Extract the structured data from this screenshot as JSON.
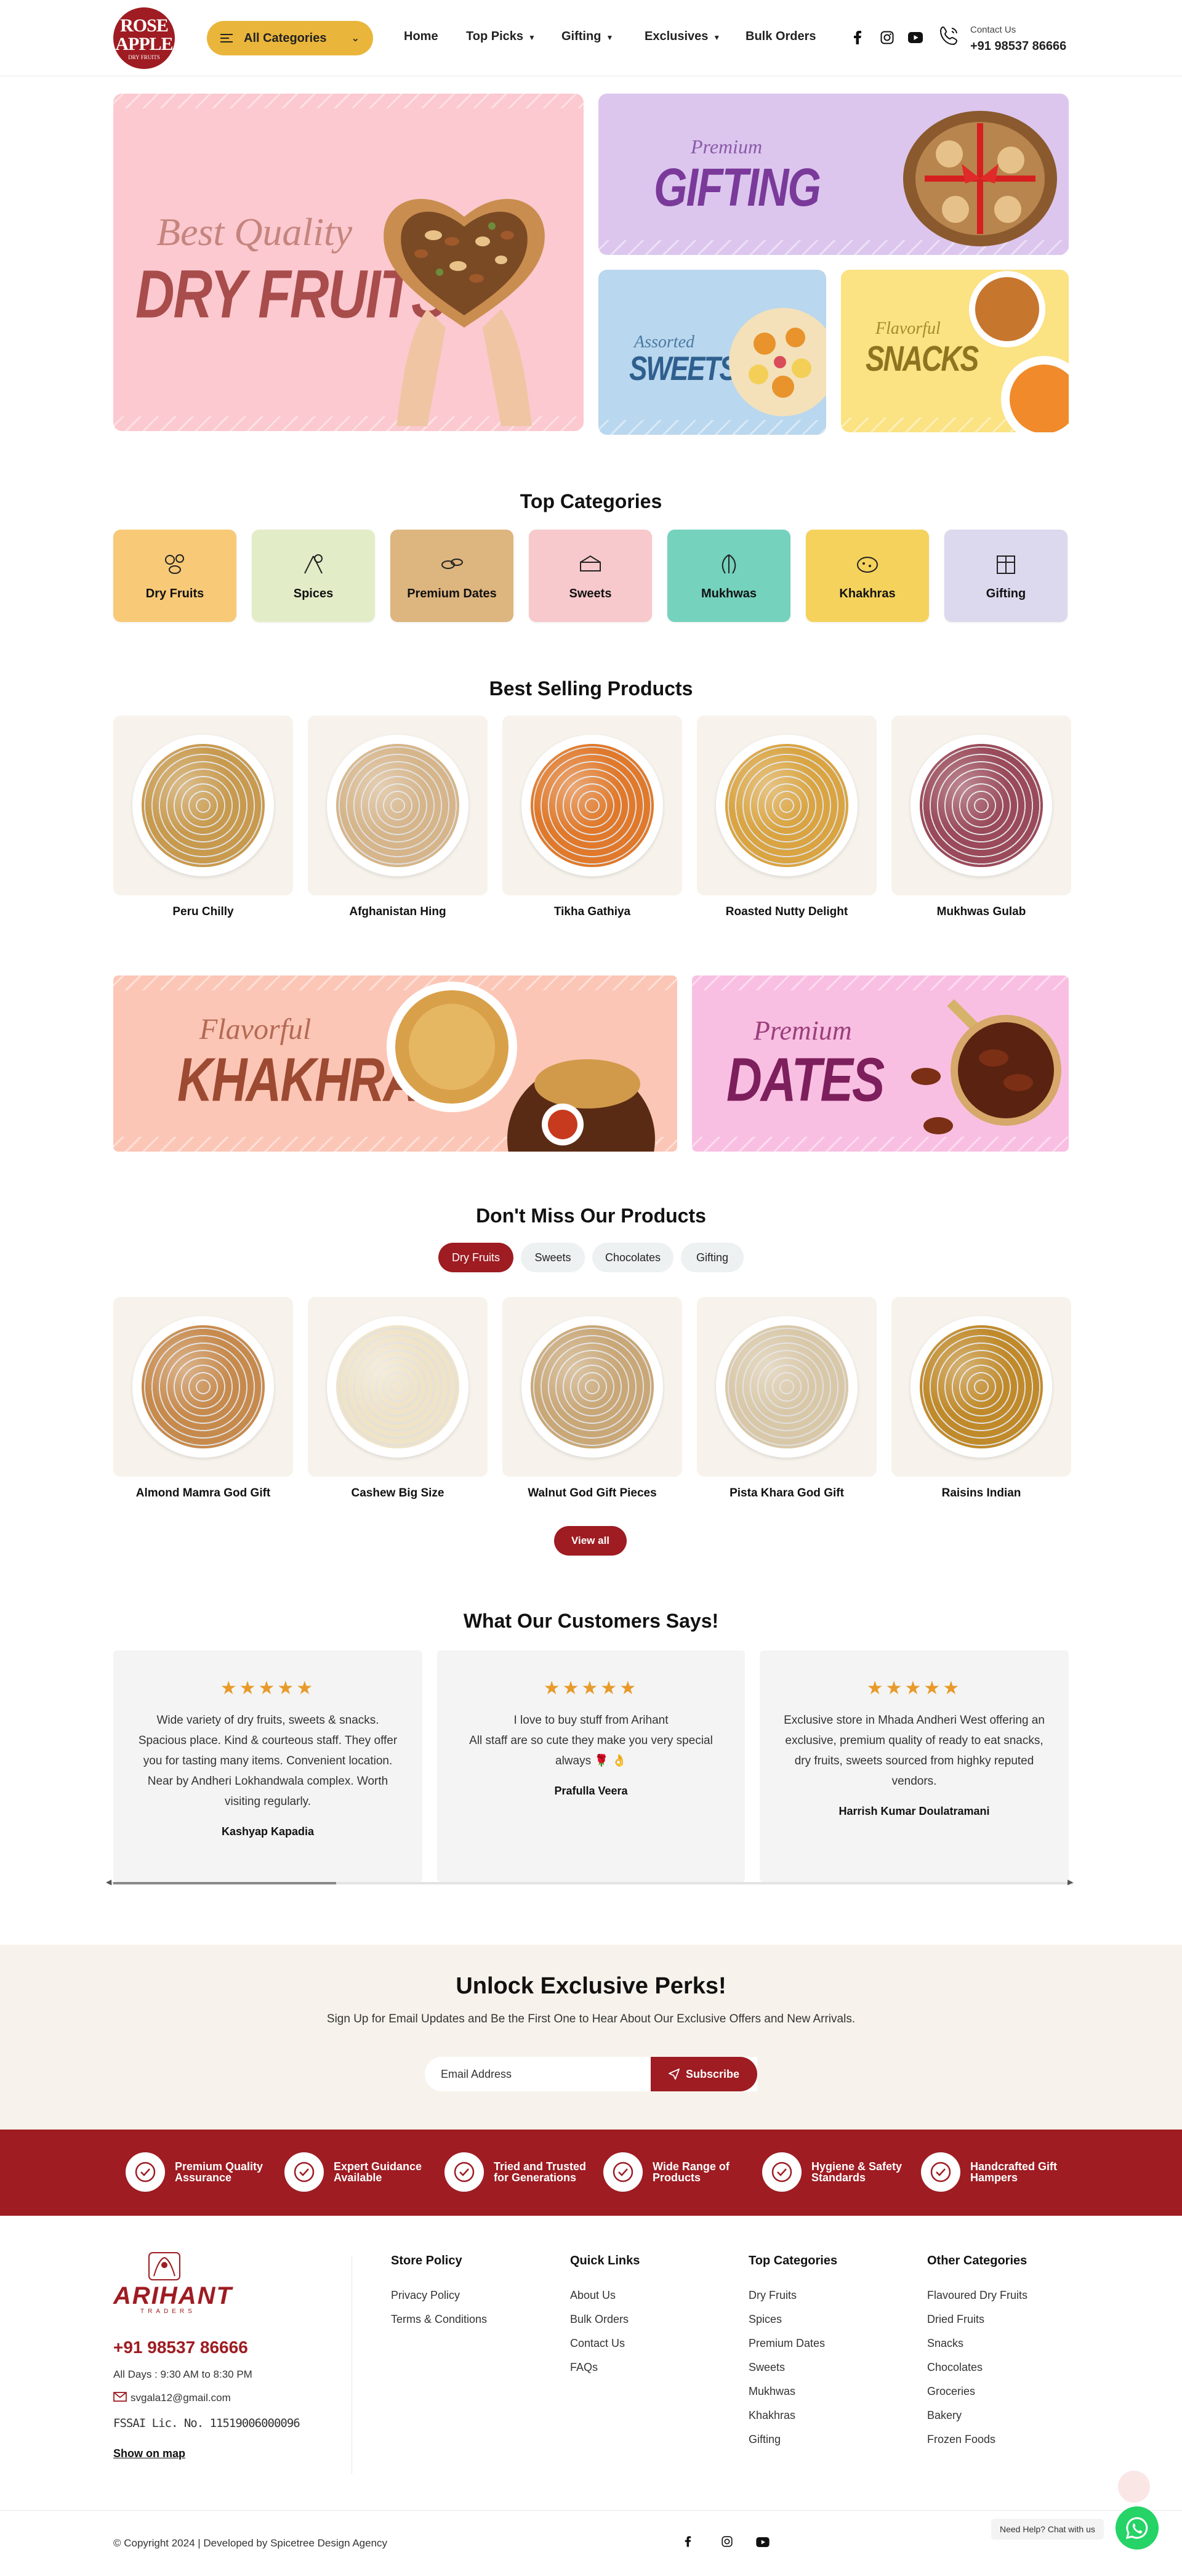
{
  "colors": {
    "brand": "#9e1c22",
    "accent": "#e9b53a",
    "cream": "#f7f3ec"
  },
  "header": {
    "logo_line1": "ROSE",
    "logo_line2": "APPLE",
    "logo_tag": "DRY FRUITS",
    "all_categories": "All Categories",
    "nav": [
      {
        "label": "Home",
        "dropdown": false
      },
      {
        "label": "Top Picks",
        "dropdown": true
      },
      {
        "label": "Gifting",
        "dropdown": true
      },
      {
        "label": "Exclusives",
        "dropdown": true
      },
      {
        "label": "Bulk Orders",
        "dropdown": false
      }
    ],
    "social_icons": [
      "facebook-icon",
      "instagram-icon",
      "youtube-icon"
    ],
    "contact_label": "Contact Us",
    "contact_number": "+91 98537 86666"
  },
  "hero": {
    "main": {
      "script": "Best Quality",
      "title": "DRY FRUITS"
    },
    "gifting": {
      "script": "Premium",
      "title": "GIFTING"
    },
    "sweets": {
      "script": "Assorted",
      "title": "SWEETS"
    },
    "snacks": {
      "script": "Flavorful",
      "title": "SNACKS"
    },
    "slides": 2,
    "active_slide": 0
  },
  "top_categories": {
    "title": "Top Categories",
    "items": [
      {
        "label": "Dry Fruits",
        "color": "#f8c977",
        "icon": "dry-fruits-icon"
      },
      {
        "label": "Spices",
        "color": "#e2edc7",
        "icon": "spices-icon"
      },
      {
        "label": "Premium Dates",
        "color": "#ddb57e",
        "icon": "dates-icon"
      },
      {
        "label": "Sweets",
        "color": "#f8c9cc",
        "icon": "sweets-icon"
      },
      {
        "label": "Mukhwas",
        "color": "#74d2bd",
        "icon": "mukhwas-icon"
      },
      {
        "label": "Khakhras",
        "color": "#f5d25c",
        "icon": "khakhra-icon"
      },
      {
        "label": "Gifting",
        "color": "#dcd9ee",
        "icon": "gift-icon"
      }
    ]
  },
  "best_selling": {
    "title": "Best Selling Products",
    "items": [
      {
        "name": "Peru Chilly",
        "food": "#c89a4e"
      },
      {
        "name": "Afghanistan Hing",
        "food": "#d6b58a"
      },
      {
        "name": "Tikha Gathiya",
        "food": "#e0792b"
      },
      {
        "name": "Roasted Nutty Delight",
        "food": "#d9a441"
      },
      {
        "name": "Mukhwas Gulab",
        "food": "#9a4a5a"
      }
    ]
  },
  "promo": {
    "khakhra": {
      "script": "Flavorful",
      "title": "KHAKHRA"
    },
    "dates": {
      "script": "Premium",
      "title": "DATES"
    }
  },
  "dont_miss": {
    "title": "Don't Miss Our Products",
    "tabs": [
      "Dry Fruits",
      "Sweets",
      "Chocolates",
      "Gifting"
    ],
    "active_tab": 0,
    "items": [
      {
        "name": "Almond Mamra God Gift",
        "food": "#c78a4d"
      },
      {
        "name": "Cashew Big Size",
        "food": "#efe3c8"
      },
      {
        "name": "Walnut God Gift Pieces",
        "food": "#c9a777"
      },
      {
        "name": "Pista Khara God Gift",
        "food": "#d9c8a8"
      },
      {
        "name": "Raisins Indian",
        "food": "#c08a2a"
      }
    ],
    "view_all": "View all"
  },
  "testimonials": {
    "title": "What Our Customers Says!",
    "stars": "★★★★★",
    "items": [
      {
        "lines": [
          "Wide variety of dry fruits, sweets & snacks.",
          "Spacious place. Kind & courteous staff. They offer",
          "you for tasting many items. Convenient location.",
          "Near by Andheri Lokhandwala complex. Worth",
          "visiting regularly."
        ],
        "name": "Kashyap Kapadia"
      },
      {
        "lines": [
          "I love to buy stuff from Arihant",
          "All staff are so cute they make you very special",
          "always 🌹 👌"
        ],
        "name": "Prafulla Veera"
      },
      {
        "lines": [
          "Exclusive store in Mhada Andheri West offering an",
          "exclusive, premium quality of ready to eat snacks,",
          "dry fruits, sweets sourced from highky reputed",
          "vendors."
        ],
        "name": "Harrish Kumar Doulatramani"
      }
    ]
  },
  "perks": {
    "title": "Unlock Exclusive Perks!",
    "subtitle": "Sign Up for Email Updates and Be the First One to Hear About Our Exclusive Offers and New Arrivals.",
    "email_placeholder": "Email Address",
    "subscribe": "Subscribe"
  },
  "features": [
    {
      "l1": "Premium Quality",
      "l2": "Assurance",
      "icon": "quality-badge-icon"
    },
    {
      "l1": "Expert Guidance",
      "l2": "Available",
      "icon": "expert-icon"
    },
    {
      "l1": "Tried and Trusted",
      "l2": "for Generations",
      "icon": "trusted-hands-icon"
    },
    {
      "l1": "Wide Range of",
      "l2": "Products",
      "icon": "products-list-icon"
    },
    {
      "l1": "Hygiene & Safety",
      "l2": "Standards",
      "icon": "hygiene-shield-icon"
    },
    {
      "l1": "Handcrafted Gift",
      "l2": "Hampers",
      "icon": "gift-hamper-icon"
    }
  ],
  "footer": {
    "brand": "ARIHANT",
    "brand_sub": "TRADERS",
    "phone": "+91 98537 86666",
    "hours": "All Days : 9:30 AM to 8:30 PM",
    "email": "svgala12@gmail.com",
    "fssai": "FSSAI Lic. No. 11519006000096",
    "map": "Show on map",
    "columns": [
      {
        "title": "Store Policy",
        "links": [
          "Privacy Policy",
          "Terms & Conditions"
        ]
      },
      {
        "title": "Quick Links",
        "links": [
          "About Us",
          "Bulk Orders",
          "Contact Us",
          "FAQs"
        ]
      },
      {
        "title": "Top Categories",
        "links": [
          "Dry Fruits",
          "Spices",
          "Premium Dates",
          "Sweets",
          "Mukhwas",
          "Khakhras",
          "Gifting"
        ]
      },
      {
        "title": "Other Categories",
        "links": [
          "Flavoured Dry Fruits",
          "Dried Fruits",
          "Snacks",
          "Chocolates",
          "Groceries",
          "Bakery",
          "Frozen Foods"
        ]
      }
    ],
    "copyright": "© Copyright 2024 | Developed by Spicetree Design Agency",
    "help": "Need Help? Chat with us"
  }
}
